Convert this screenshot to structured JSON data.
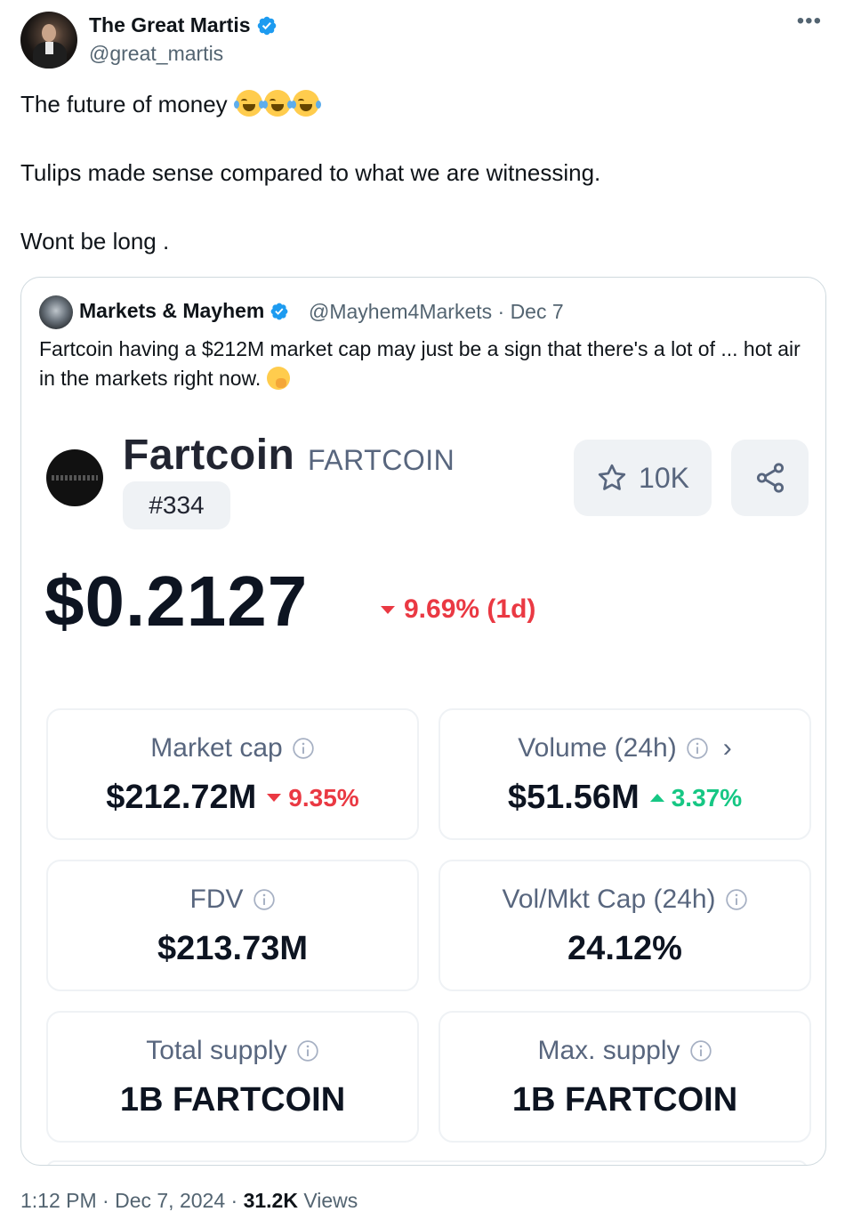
{
  "author": {
    "display_name": "The Great Martis",
    "handle": "@great_martis"
  },
  "tweet": {
    "line1": "The future of money ",
    "line2": "Tulips made sense compared to what we are witnessing.",
    "line3": "Wont be long ."
  },
  "quoted": {
    "display_name": "Markets & Mayhem",
    "handle_and_date": "@Mayhem4Markets · Dec 7",
    "text": "Fartcoin having a $212M market cap may just be a sign that there's a lot of ... hot air in the markets right now. "
  },
  "coin": {
    "name": "Fartcoin",
    "symbol": "FARTCOIN",
    "rank": "#334",
    "watchlist_count": "10K",
    "price": "$0.2127",
    "price_change": "9.69% (1d)",
    "stats": [
      {
        "label": "Market cap",
        "value": "$212.72M",
        "change": "9.35%",
        "direction": "down"
      },
      {
        "label": "Volume (24h)",
        "value": "$51.56M",
        "change": "3.37%",
        "direction": "up"
      },
      {
        "label": "FDV",
        "value": "$213.73M"
      },
      {
        "label": "Vol/Mkt Cap (24h)",
        "value": "24.12%"
      },
      {
        "label": "Total supply",
        "value": "1B FARTCOIN"
      },
      {
        "label": "Max. supply",
        "value": "1B FARTCOIN"
      }
    ]
  },
  "footer": {
    "time_date": "1:12 PM · Dec 7, 2024 · ",
    "views_count": "31.2K",
    "views_label": " Views"
  },
  "colors": {
    "verified": "#1d9bf0",
    "negative": "#ea3943",
    "positive": "#16c784"
  },
  "icons": [
    "verified-badge-icon",
    "more-icon",
    "tears-of-joy-emoji",
    "face-with-hand-over-mouth-emoji",
    "star-icon",
    "share-icon",
    "info-icon",
    "chevron-right-icon",
    "triangle-down-icon",
    "triangle-up-icon"
  ]
}
